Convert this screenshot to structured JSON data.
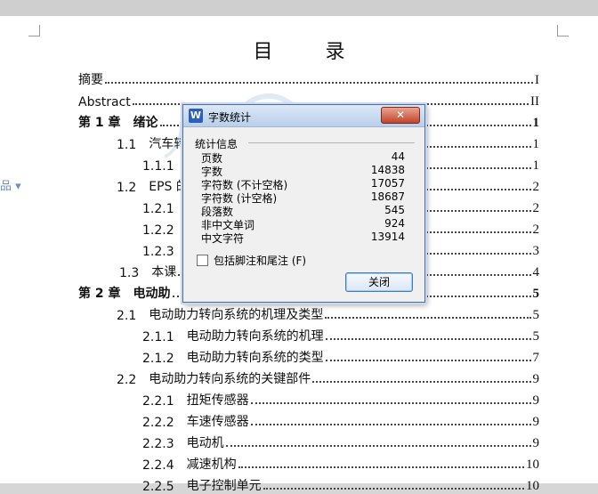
{
  "document": {
    "title": "目 录",
    "left_marker": "品 ▾",
    "toc": [
      {
        "num": "",
        "label": "摘要",
        "page": "I",
        "level": 0,
        "chapter": false
      },
      {
        "num": "",
        "label": "Abstract",
        "page": "II",
        "level": 0,
        "chapter": false
      },
      {
        "num": "第 1 章",
        "label": "绪论",
        "page": "1",
        "level": 0,
        "chapter": true
      },
      {
        "num": "1.1",
        "label": "汽车转",
        "page": "1",
        "level": 1,
        "chapter": false
      },
      {
        "num": "1.1.1",
        "label": "",
        "page": "1",
        "level": 2,
        "chapter": false
      },
      {
        "num": "1.2",
        "label": "EPS 的",
        "page": "2",
        "level": 1,
        "chapter": false
      },
      {
        "num": "1.2.1",
        "label": "",
        "page": "2",
        "level": 2,
        "chapter": false
      },
      {
        "num": "1.2.2",
        "label": "",
        "page": "2",
        "level": 2,
        "chapter": false
      },
      {
        "num": "1.2.3",
        "label": "",
        "page": "3",
        "level": 2,
        "chapter": false
      },
      {
        "num": "1.3",
        "label": "本课",
        "page": "4",
        "level": 1,
        "chapter": false
      },
      {
        "num": "第 2 章",
        "label": "电动助",
        "page": "5",
        "level": 0,
        "chapter": true
      },
      {
        "num": "2.1",
        "label": "电动助力转向系统的机理及类型",
        "page": "5",
        "level": 1,
        "chapter": false
      },
      {
        "num": "2.1.1",
        "label": "电动助力转向系统的机理",
        "page": "5",
        "level": 2,
        "chapter": false
      },
      {
        "num": "2.1.2",
        "label": "电动助力转向系统的类型",
        "page": "7",
        "level": 2,
        "chapter": false
      },
      {
        "num": "2.2",
        "label": "电动助力转向系统的关键部件",
        "page": "9",
        "level": 1,
        "chapter": false
      },
      {
        "num": "2.2.1",
        "label": "扭矩传感器",
        "page": "9",
        "level": 2,
        "chapter": false
      },
      {
        "num": "2.2.2",
        "label": "车速传感器",
        "page": "9",
        "level": 2,
        "chapter": false
      },
      {
        "num": "2.2.3",
        "label": "电动机",
        "page": "9",
        "level": 2,
        "chapter": false
      },
      {
        "num": "2.2.4",
        "label": "减速机构",
        "page": "10",
        "level": 2,
        "chapter": false
      },
      {
        "num": "2.2.5",
        "label": "电子控制单元",
        "page": "10",
        "level": 2,
        "chapter": false
      }
    ]
  },
  "dialog": {
    "app_icon": "W",
    "title": "字数统计",
    "close_x": "✕",
    "section_header": "统计信息",
    "stats": [
      {
        "label": "页数",
        "value": "44"
      },
      {
        "label": "字数",
        "value": "14838"
      },
      {
        "label": "字符数 (不计空格)",
        "value": "17057"
      },
      {
        "label": "字符数 (计空格)",
        "value": "18687"
      },
      {
        "label": "段落数",
        "value": "545"
      },
      {
        "label": "非中文单词",
        "value": "924"
      },
      {
        "label": "中文字符",
        "value": "13914"
      }
    ],
    "checkbox_label": "包括脚注和尾注 (F)",
    "checkbox_checked": false,
    "close_button": "关闭"
  },
  "watermark": {
    "chars": [
      "人",
      "人",
      "文",
      "库"
    ],
    "url": "www.renrendoc.com"
  }
}
